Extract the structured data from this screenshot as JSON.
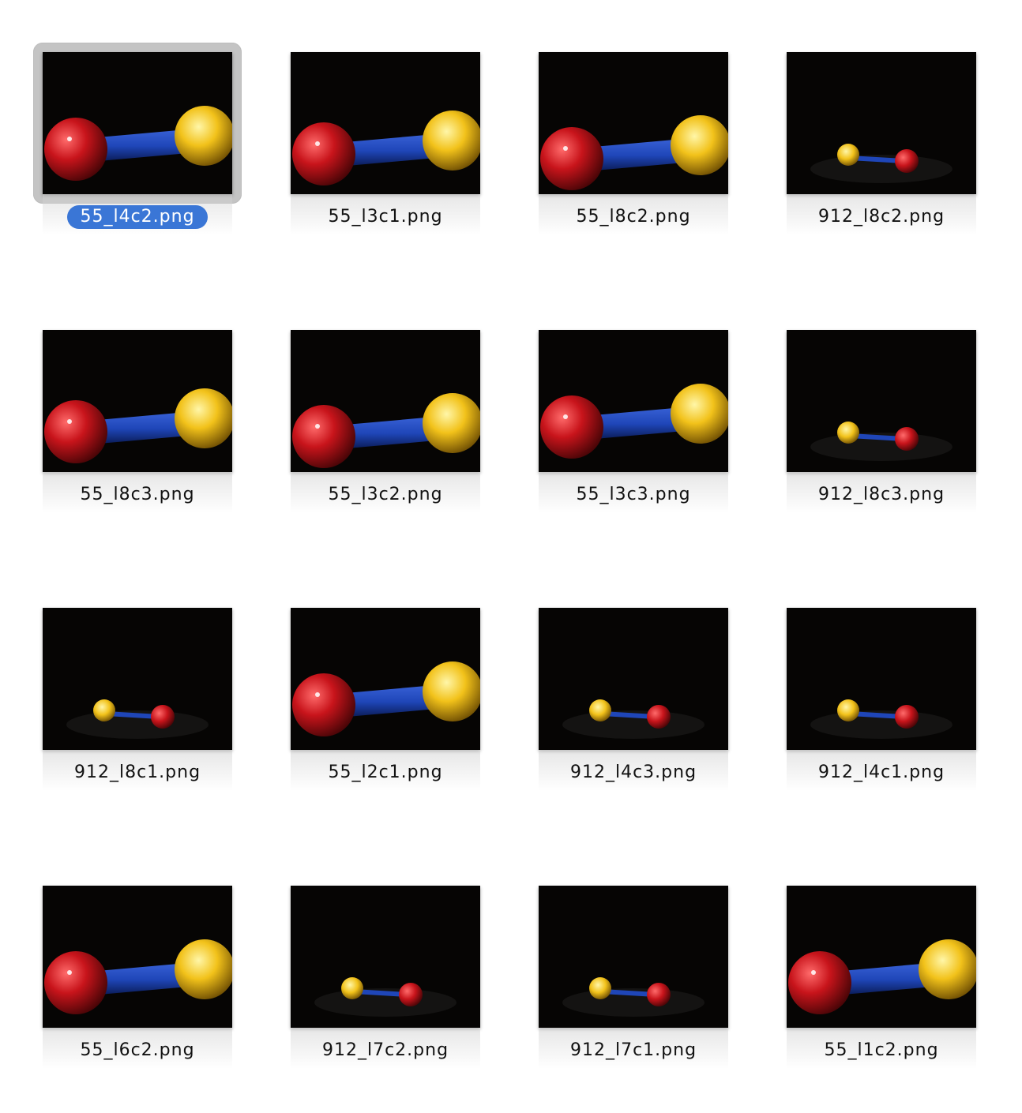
{
  "files": [
    {
      "name": "55_l4c2.png",
      "selected": true,
      "variant": "large"
    },
    {
      "name": "55_l3c1.png",
      "selected": false,
      "variant": "large"
    },
    {
      "name": "55_l8c2.png",
      "selected": false,
      "variant": "large"
    },
    {
      "name": "912_l8c2.png",
      "selected": false,
      "variant": "small"
    },
    {
      "name": "55_l8c3.png",
      "selected": false,
      "variant": "large"
    },
    {
      "name": "55_l3c2.png",
      "selected": false,
      "variant": "large"
    },
    {
      "name": "55_l3c3.png",
      "selected": false,
      "variant": "large"
    },
    {
      "name": "912_l8c3.png",
      "selected": false,
      "variant": "small"
    },
    {
      "name": "912_l8c1.png",
      "selected": false,
      "variant": "small"
    },
    {
      "name": "55_l2c1.png",
      "selected": false,
      "variant": "large"
    },
    {
      "name": "912_l4c3.png",
      "selected": false,
      "variant": "small"
    },
    {
      "name": "912_l4c1.png",
      "selected": false,
      "variant": "small"
    },
    {
      "name": "55_l6c2.png",
      "selected": false,
      "variant": "large"
    },
    {
      "name": "912_l7c2.png",
      "selected": false,
      "variant": "small"
    },
    {
      "name": "912_l7c1.png",
      "selected": false,
      "variant": "small"
    },
    {
      "name": "55_l1c2.png",
      "selected": false,
      "variant": "large"
    }
  ],
  "colors": {
    "red_ball": "#c8141b",
    "yellow_ball": "#f2c21a",
    "blue_rod": "#1f46b8",
    "background": "#060504",
    "selection_label": "#3a76d6"
  }
}
